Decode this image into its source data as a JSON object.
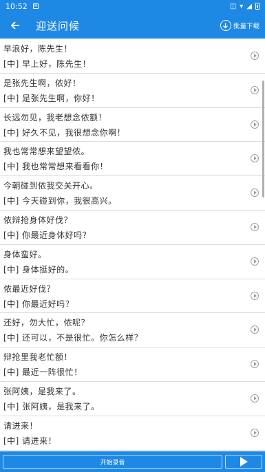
{
  "status_bar": {
    "time": "10:52"
  },
  "header": {
    "title": "迎送问候",
    "batch_download_label": "批量下载"
  },
  "phrases": [
    {
      "original": "早浪好，陈先生！",
      "translation": "[中] 早上好，陈先生！"
    },
    {
      "original": "是张先生啊，侬好！",
      "translation": "[中] 是张先生啊，你好！"
    },
    {
      "original": "长远勿见，我老想念侬额！",
      "translation": "[中] 好久不见，我很想念你啊！"
    },
    {
      "original": "我也常常想来望望侬。",
      "translation": "[中] 我也常常想来看看你！"
    },
    {
      "original": "今朝碰到侬我交关开心。",
      "translation": "[中] 今天碰到你，我很高兴。"
    },
    {
      "original": "侬辩抢身体好伐？",
      "translation": "[中] 你最近身体好吗？"
    },
    {
      "original": "身体蛮好。",
      "translation": "[中] 身体挺好的。"
    },
    {
      "original": "侬最近好伐？",
      "translation": "[中] 你最近好吗？"
    },
    {
      "original": "还好，勿大忙，侬呢？",
      "translation": "[中] 还可以，不是很忙。你怎么样？"
    },
    {
      "original": "辩抢里我老忙额！",
      "translation": "[中] 最近一阵很忙！"
    },
    {
      "original": "张阿姨，是我来了。",
      "translation": "[中] 张阿姨，是我来了。"
    },
    {
      "original": "请进来！",
      "translation": "[中] 请进来！"
    }
  ],
  "bottom_bar": {
    "record_label": "开始录音"
  },
  "icons": {
    "back": "arrow-left-icon",
    "download": "download-circle-icon",
    "play": "play-circle-icon",
    "play_all": "play-icon"
  },
  "colors": {
    "primary": "#1e88e5",
    "text": "#333333",
    "divider": "#dcdcdc",
    "icon_gray": "#9e9e9e"
  }
}
